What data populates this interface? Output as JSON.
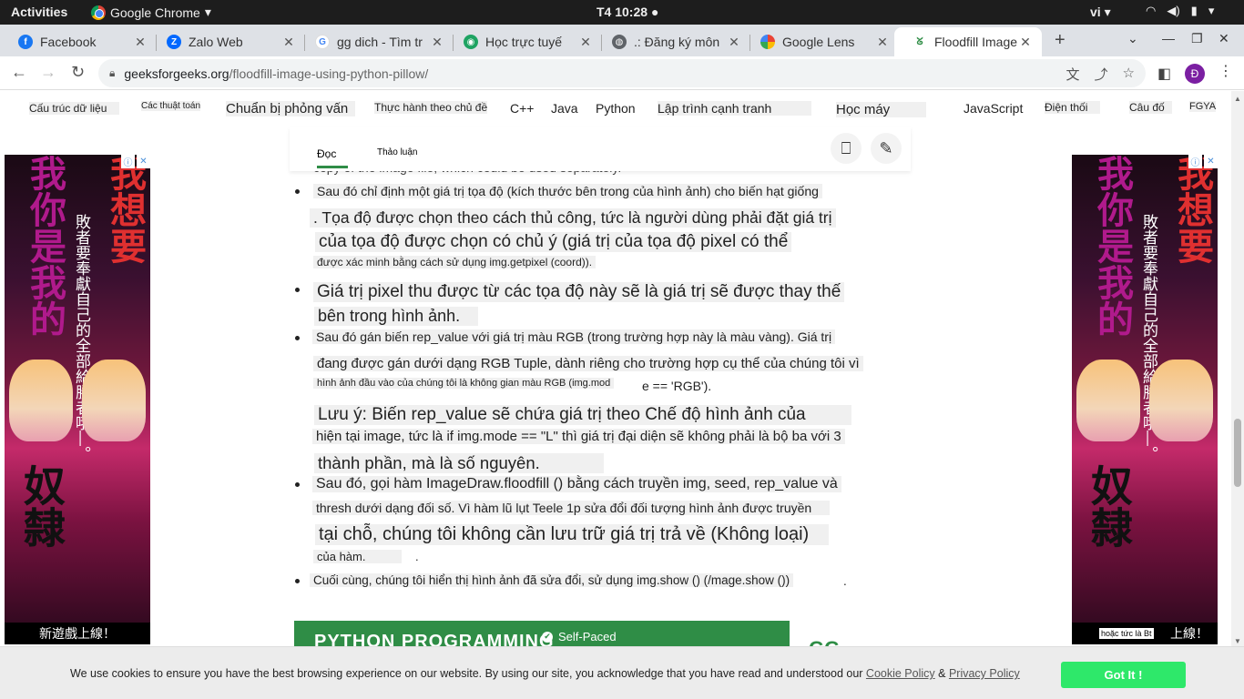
{
  "system": {
    "activities": "Activities",
    "app_name": "Google Chrome",
    "clock": "T4 10:28",
    "language": "vi"
  },
  "tabs": [
    {
      "title": "Facebook",
      "icon": "facebook-icon",
      "color": "#1877f2"
    },
    {
      "title": "Zalo Web",
      "icon": "zalo-icon",
      "color": "#0068ff"
    },
    {
      "title": "gg dich - Tìm tr",
      "icon": "google-icon",
      "color": "#4285f4"
    },
    {
      "title": "Học trực tuyế",
      "icon": "study-icon",
      "color": "#1ea362"
    },
    {
      "title": ".: Đăng ký môn",
      "icon": "globe-icon",
      "color": "#5f6368"
    },
    {
      "title": "Google Lens",
      "icon": "lens-icon",
      "color": "#ea4335"
    },
    {
      "title": "Floodfill Image",
      "icon": "gfg-icon",
      "color": "#2f8d46"
    }
  ],
  "address": {
    "domain": "geeksforgeeks.org",
    "path": "/floodfill-image-using-python-pillow/"
  },
  "profile_initial": "Đ",
  "categories": [
    "Cấu trúc dữ liệu",
    "Các thuật toán",
    "Chuẩn bị phỏng vấn",
    "Thực hành theo chủ đề",
    "C++",
    "Java",
    "Python",
    "Lập trình cạnh tranh",
    "Học máy",
    "JavaScript",
    "Điện thối",
    "Câu đố",
    "FGYA"
  ],
  "article": {
    "tab_read": "Đọc",
    "tab_discuss": "Thảo luận",
    "behind_text": "copy of the image file, which could be used separately.",
    "lines": [
      "Sau đó chỉ định một giá trị tọa độ (kích thước bên trong của hình ảnh) cho biến hạt giống",
      ". Tọa độ được chọn theo cách thủ công, tức là người dùng phải đặt giá trị",
      "của tọa độ được chọn có chủ ý (giá trị của tọa độ pixel có thể",
      "được xác minh bằng cách sử dụng img.getpixel (coord)).",
      "Giá trị pixel thu được từ các tọa độ này sẽ là giá trị sẽ được thay thế",
      "bên trong hình ảnh.",
      "Sau đó gán biến rep_value với giá trị màu RGB (trong trường hợp này là màu vàng). Giá trị",
      "đang được gán dưới dạng RGB Tuple, dành riêng cho trường hợp cụ thể của chúng tôi vì",
      "hình ảnh đầu vào của chúng tôi là không gian màu RGB (img.mod",
      "e == 'RGB').",
      "Lưu ý: Biến rep_value sẽ chứa giá trị theo Chế độ hình ảnh của",
      "hiện tại image, tức là if img.mode == \"L\" thì giá trị đại diện sẽ không phải là bộ ba với 3",
      "thành phần, mà là số nguyên.",
      "Sau đó, gọi hàm ImageDraw.floodfill () bằng cách truyền img, seed, rep_value và",
      "thresh dưới dạng đối số. Vì hàm lũ lụt Teele 1p sửa đổi đối tượng hình ảnh được truyền",
      "tại chỗ, chúng tôi không cần lưu trữ giá trị trả về (Không loại)",
      "của hàm.",
      ".",
      "Cuối cùng, chúng tôi hiển thị hình ảnh đã sửa đổi, sử dụng img.show () (/mage.show ())",
      "."
    ],
    "banner_title": "PYTHON PROGRAMMING",
    "banner_badge": "Self-Paced",
    "gfg_mark": "GG"
  },
  "ads": {
    "left_col": "我你是我的",
    "right_col": "我想要",
    "middle_text": "敗者要奉獻自己的全部給勝者哦—。",
    "bottom_left": "新遊戲上線！",
    "bottom_right": "上線！",
    "right_tooltip": "hoặc tức là Bt",
    "bottom_chars": "奴隸"
  },
  "cookie": {
    "text": "We use cookies to ensure you have the best browsing experience on our website. By using our site, you acknowledge that you have read and understood our ",
    "policy_link": "Cookie Policy",
    "amp": " & ",
    "privacy_link": "Privacy Policy",
    "button": "Got It !"
  }
}
